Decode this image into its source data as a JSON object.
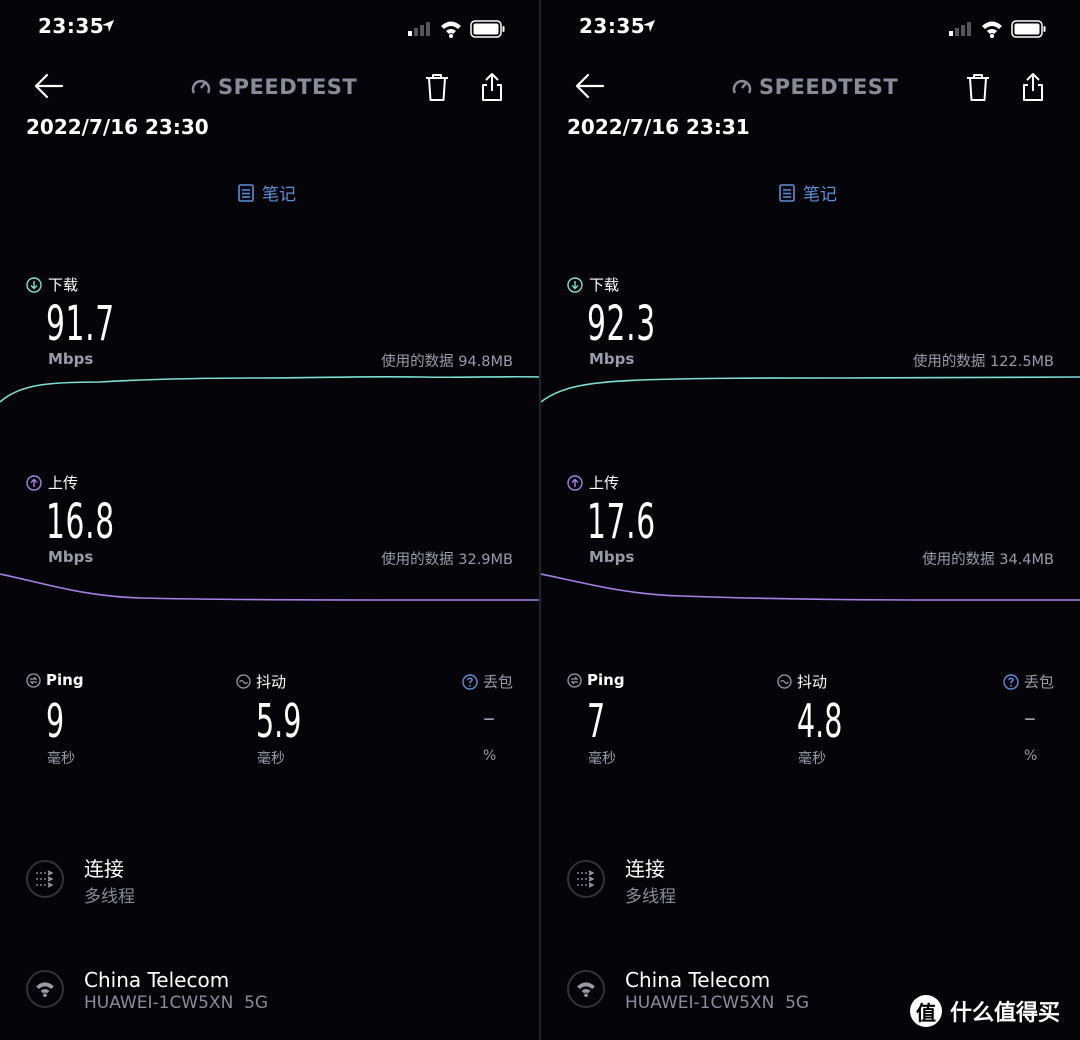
{
  "status_bar": {
    "time": "23:35"
  },
  "header": {
    "logo": "SPEEDTEST"
  },
  "notes_label": "笔记",
  "screens": [
    {
      "date": "2022/7/16 23:30",
      "download": {
        "label": "下载",
        "value": "91.7",
        "unit": "Mbps",
        "data_used": "使用的数据 94.8MB"
      },
      "upload": {
        "label": "上传",
        "value": "16.8",
        "unit": "Mbps",
        "data_used": "使用的数据 32.9MB"
      },
      "ping": {
        "label": "Ping",
        "value": "9",
        "unit": "毫秒"
      },
      "jitter": {
        "label": "抖动",
        "value": "5.9",
        "unit": "毫秒"
      },
      "loss": {
        "label": "丢包",
        "value": "–",
        "unit": "%"
      },
      "connection": {
        "title": "连接",
        "subtitle": "多线程"
      },
      "network": {
        "provider": "China Telecom",
        "ssid": "HUAWEI-1CW5XN  5G"
      }
    },
    {
      "date": "2022/7/16 23:31",
      "download": {
        "label": "下载",
        "value": "92.3",
        "unit": "Mbps",
        "data_used": "使用的数据 122.5MB"
      },
      "upload": {
        "label": "上传",
        "value": "17.6",
        "unit": "Mbps",
        "data_used": "使用的数据 34.4MB"
      },
      "ping": {
        "label": "Ping",
        "value": "7",
        "unit": "毫秒"
      },
      "jitter": {
        "label": "抖动",
        "value": "4.8",
        "unit": "毫秒"
      },
      "loss": {
        "label": "丢包",
        "value": "–",
        "unit": "%"
      },
      "connection": {
        "title": "连接",
        "subtitle": "多线程"
      },
      "network": {
        "provider": "China Telecom",
        "ssid": "HUAWEI-1CW5XN  5G"
      }
    }
  ],
  "watermark": {
    "glyph": "值",
    "text": "什么值得买"
  },
  "colors": {
    "download": "#7de0cf",
    "upload": "#a77fe6",
    "accent": "#5a8fd9",
    "background": "#050509"
  }
}
